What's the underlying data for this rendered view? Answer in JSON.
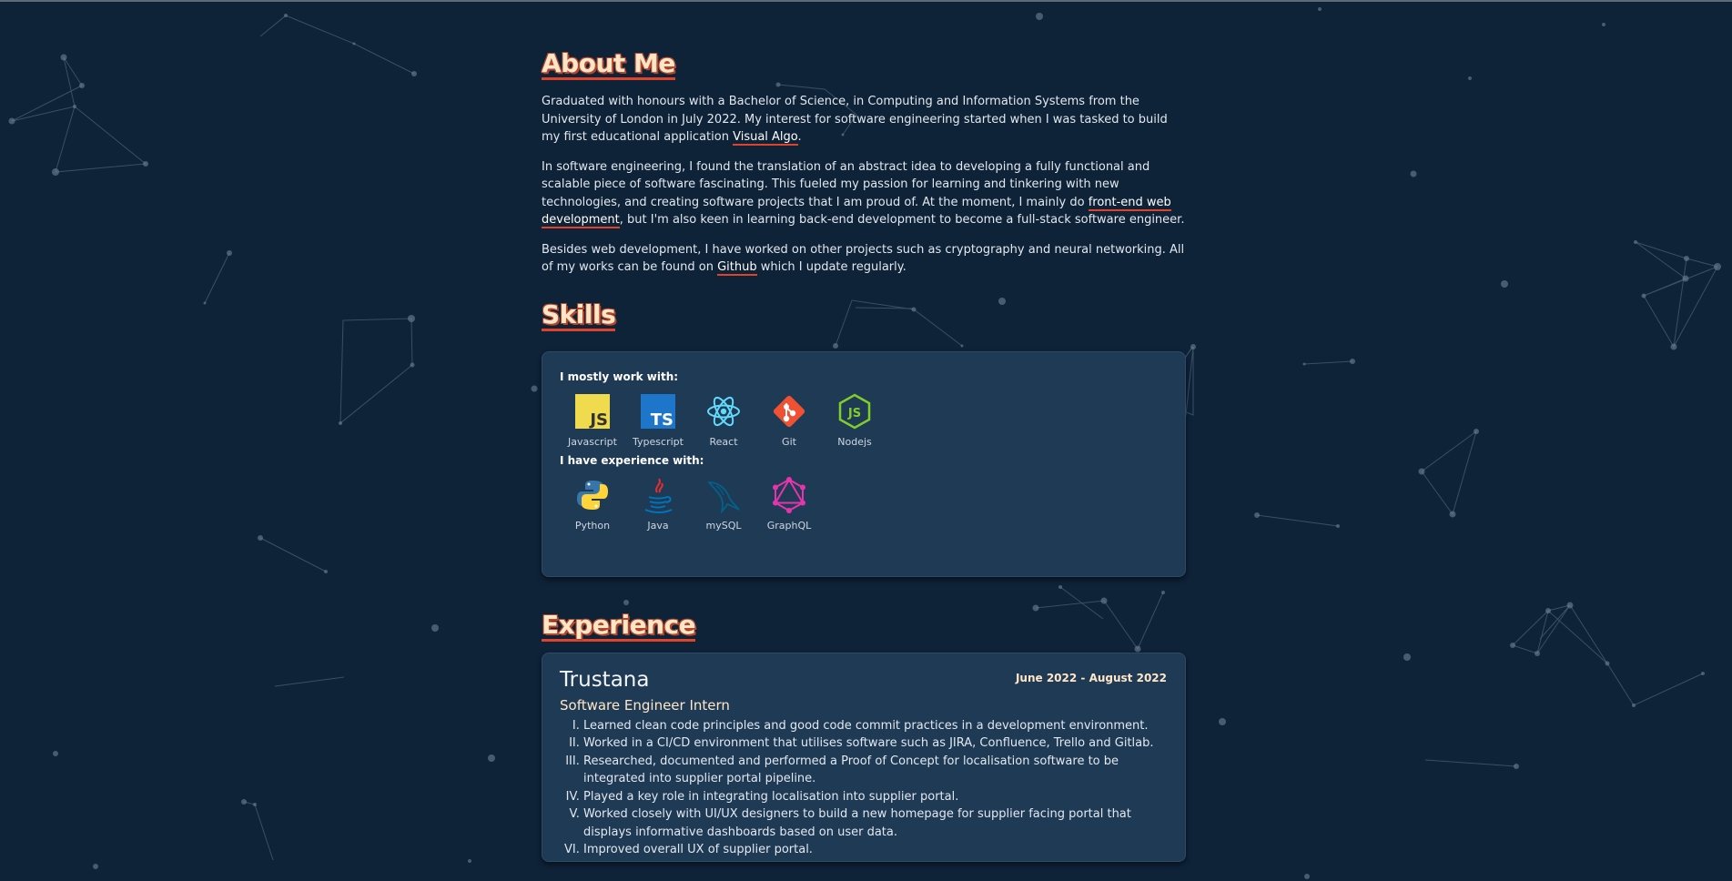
{
  "about": {
    "heading": "About Me",
    "p1_before": "Graduated with honours with a Bachelor of Science, in Computing and Information Systems from the University of London in July 2022. My interest for software engineering started when I was tasked to build my first educational application ",
    "p1_link": "Visual Algo",
    "p1_after": ".",
    "p2_before": "In software engineering, I found the translation of an abstract idea to developing a fully functional and scalable piece of software fascinating. This fueled my passion for learning and tinkering with new technologies, and creating software projects that I am proud of. At the moment, I mainly do ",
    "p2_link": "front-end web development",
    "p2_after": ", but I'm also keen in learning back-end development to become a full-stack software engineer.",
    "p3_before": "Besides web development, I have worked on other projects such as cryptography and neural networking. All of my works can be found on ",
    "p3_link": "Github",
    "p3_after": " which I update regularly."
  },
  "skills": {
    "heading": "Skills",
    "primary_label": "I mostly work with:",
    "primary": [
      {
        "name": "Javascript",
        "icon": "javascript-icon"
      },
      {
        "name": "Typescript",
        "icon": "typescript-icon"
      },
      {
        "name": "React",
        "icon": "react-icon"
      },
      {
        "name": "Git",
        "icon": "git-icon"
      },
      {
        "name": "Nodejs",
        "icon": "nodejs-icon"
      }
    ],
    "secondary_label": "I have experience with:",
    "secondary": [
      {
        "name": "Python",
        "icon": "python-icon"
      },
      {
        "name": "Java",
        "icon": "java-icon"
      },
      {
        "name": "mySQL",
        "icon": "mysql-icon"
      },
      {
        "name": "GraphQL",
        "icon": "graphql-icon"
      }
    ]
  },
  "experience": {
    "heading": "Experience",
    "company": "Trustana",
    "dates": "June 2022 - August 2022",
    "role": "Software Engineer Intern",
    "duties": [
      "Learned clean code principles and good code commit practices in a development environment.",
      "Worked in a CI/CD environment that utilises software such as JIRA, Confluence, Trello and Gitlab.",
      "Researched, documented and performed a Proof of Concept for localisation software to be integrated into supplier portal pipeline.",
      "Played a key role in integrating localisation into supplier portal.",
      "Worked closely with UI/UX designers to build a new homepage for supplier facing portal that displays informative dashboards based on user data.",
      "Improved overall UX of supplier portal."
    ]
  },
  "colors": {
    "background": "#0e2238",
    "card": "#1f3a55",
    "accent": "#e1432a",
    "heading": "#ffe6c7"
  }
}
